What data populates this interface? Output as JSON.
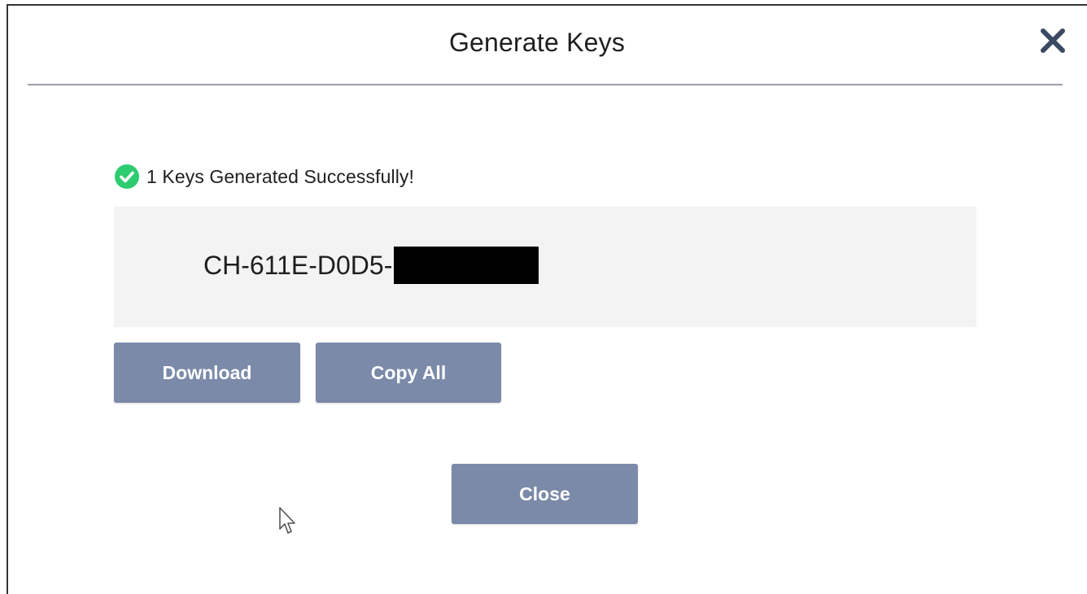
{
  "dialog": {
    "title": "Generate Keys",
    "close_icon": "close-x-icon"
  },
  "status": {
    "icon": "check-circle-icon",
    "icon_color": "#2ecc71",
    "message": "1 Keys Generated Successfully!"
  },
  "keys": [
    {
      "visible_prefix": "CH-611E-D0D5-",
      "suffix_redacted": true
    }
  ],
  "actions": {
    "download_label": "Download",
    "copy_all_label": "Copy All",
    "close_label": "Close",
    "button_color": "#7b8aa8"
  }
}
